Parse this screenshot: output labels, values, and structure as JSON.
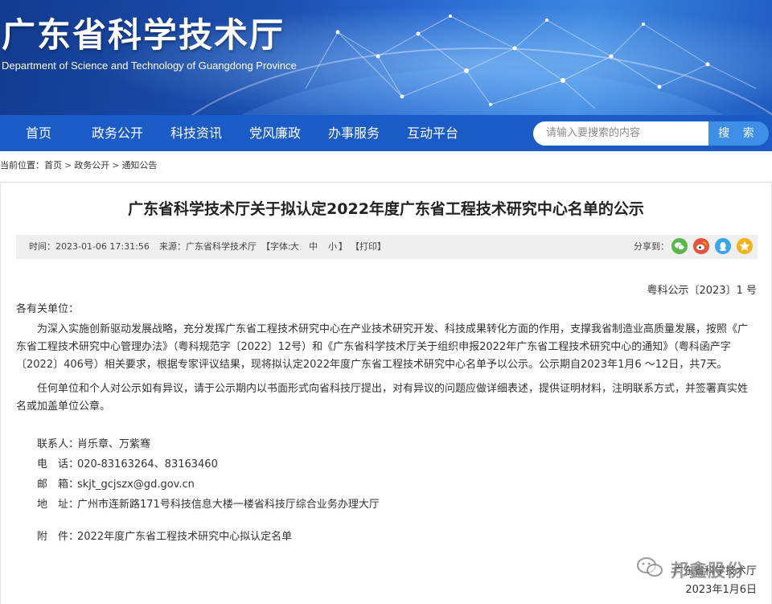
{
  "header": {
    "site_title": "广东省科学技术厅",
    "site_subtitle": "Department of Science and Technology of Guangdong Province"
  },
  "nav": {
    "items": [
      "首页",
      "政务公开",
      "科技资讯",
      "党风廉政",
      "办事服务",
      "互动平台"
    ],
    "search_placeholder": "请输入要搜索的内容",
    "search_button": "搜 索"
  },
  "breadcrumb": {
    "prefix": "当前位置：",
    "items": [
      "首页",
      "政务公开",
      "通知公告"
    ],
    "separator": ">"
  },
  "article": {
    "title": "广东省科学技术厅关于拟认定2022年度广东省工程技术研究中心名单的公示",
    "meta": {
      "time": "时间：2023-01-06 17:31:56",
      "source": "来源：广东省科学技术厅",
      "font_label": "【字体:",
      "font_large": "大",
      "font_medium": "中",
      "font_small": "小",
      "font_close": "】",
      "print": "【打印】",
      "share_label": "分享到："
    },
    "doc_number": "粤科公示〔2023〕1 号",
    "salutation": "各有关单位：",
    "paragraphs": [
      "为深入实施创新驱动发展战略，充分发挥广东省工程技术研究中心在产业技术研究开发、科技成果转化方面的作用，支撑我省制造业高质量发展，按照《广东省工程技术研究中心管理办法》（粤科规范字〔2022〕12号）和《广东省科学技术厅关于组织申报2022年广东省工程技术研究中心的通知》（粤科函产字〔2022〕406号）相关要求，根据专家评议结果，现将拟认定2022年度广东省工程技术研究中心名单予以公示。公示期自2023年1月6 ～12日，共7天。",
      "任何单位和个人对公示如有异议，请于公示期内以书面形式向省科技厅提出，对有异议的问题应做详细表述，提供证明材料，注明联系方式，并签署真实姓名或加盖单位公章。"
    ],
    "contacts": [
      {
        "label": "联系人：",
        "value": "肖乐章、万紫骞"
      },
      {
        "label": "电　话：",
        "value": "020-83163264、83163460"
      },
      {
        "label": "邮　箱：",
        "value": "skjt_gcjszx@gd.gov.cn"
      },
      {
        "label": "地　址：",
        "value": "广州市连新路171号科技信息大楼一楼省科技厅综合业务办理大厅"
      }
    ],
    "attachment": {
      "label": "附　件：",
      "value": "2022年度广东省工程技术研究中心拟认定名单"
    },
    "signer": "广东省科学技术厅",
    "date": "2023年1月6日"
  },
  "watermark": {
    "text": "邦鑫股份"
  },
  "colors": {
    "nav_bg": "#1a5bc6",
    "search_button": "#3d8fe8",
    "meta_bg": "#efefef",
    "share_wechat": "#5ab54a",
    "share_weibo": "#e5533c",
    "share_qq": "#3aa5e8",
    "share_qzone": "#f3b318"
  }
}
